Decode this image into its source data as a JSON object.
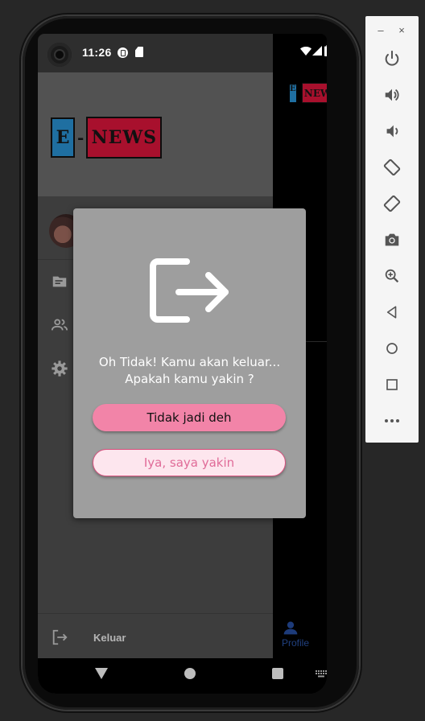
{
  "status_bar": {
    "time": "11:26"
  },
  "drawer": {
    "logo": {
      "left": "E",
      "dash": "-",
      "right": "NEWS"
    },
    "items": [
      {
        "icon": "document-icon"
      },
      {
        "icon": "people-icon"
      },
      {
        "icon": "gear-icon"
      }
    ],
    "logout_label": "Keluar"
  },
  "background": {
    "mini_logo": {
      "left": "E",
      "right": "NEWS"
    },
    "bottom_tab": {
      "label": "Profile",
      "icon": "person-icon"
    }
  },
  "dialog": {
    "icon": "logout-icon",
    "message_line1": "Oh Tidak! Kamu akan keluar...",
    "message_line2": "Apakah kamu yakin ?",
    "cancel_label": "Tidak jadi deh",
    "confirm_label": "Iya, saya yakin"
  },
  "colors": {
    "accent_pink": "#f284a8",
    "confirm_text": "#e06b98",
    "logo_blue": "#1f6fa1",
    "logo_red": "#a8102d"
  },
  "emulator_panel": {
    "minimize": "–",
    "close": "×",
    "buttons": [
      "power-icon",
      "volume-up-icon",
      "volume-down-icon",
      "rotate-left-icon",
      "rotate-right-icon",
      "camera-icon",
      "zoom-icon",
      "back-icon",
      "home-icon",
      "overview-icon",
      "more-icon"
    ]
  }
}
